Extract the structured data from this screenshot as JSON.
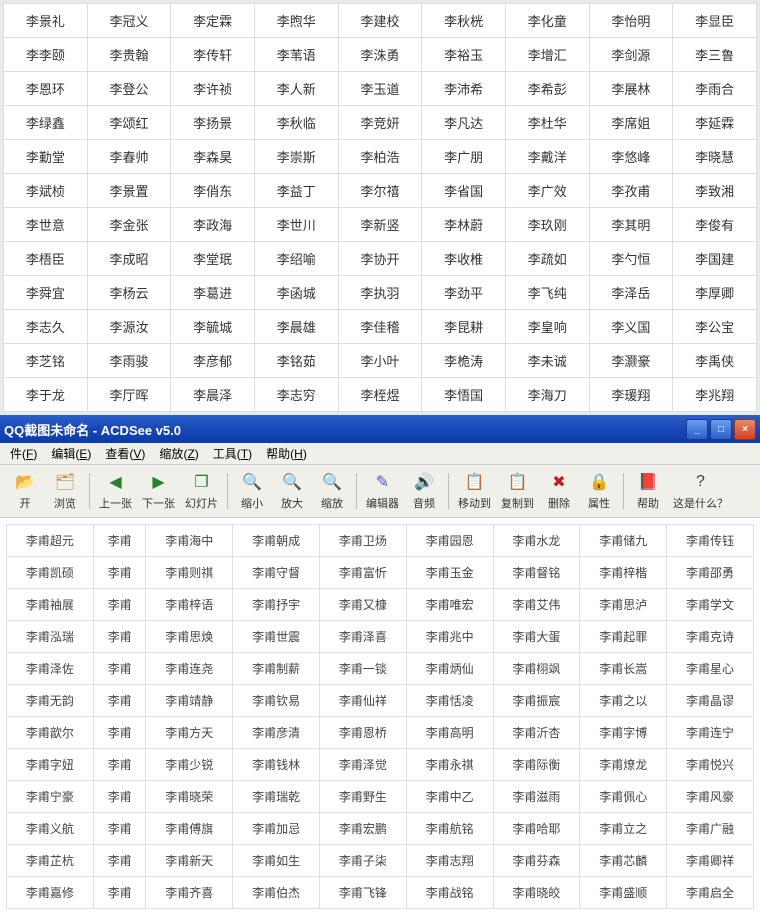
{
  "topTable": [
    [
      "李景礼",
      "李冠义",
      "李定霖",
      "李煦华",
      "李建校",
      "李秋桄",
      "李化童",
      "李怡明",
      "李显臣"
    ],
    [
      "李李颐",
      "李贵翰",
      "李传轩",
      "李苇语",
      "李洙勇",
      "李裕玉",
      "李增汇",
      "李剑源",
      "李三鲁"
    ],
    [
      "李恩环",
      "李登公",
      "李许祯",
      "李人新",
      "李玉道",
      "李沛希",
      "李希彭",
      "李展林",
      "李雨合"
    ],
    [
      "李绿鑫",
      "李颂红",
      "李扬景",
      "李秋临",
      "李竞妍",
      "李凡达",
      "李杜华",
      "李席姐",
      "李延霖"
    ],
    [
      "李勤堂",
      "李春帅",
      "李森昊",
      "李崇斯",
      "李柏浩",
      "李广朋",
      "李戴洋",
      "李悠峰",
      "李晓慧"
    ],
    [
      "李斌桢",
      "李景置",
      "李俏东",
      "李益丁",
      "李尔禧",
      "李省国",
      "李广效",
      "李孜甫",
      "李致湘"
    ],
    [
      "李世意",
      "李金张",
      "李政海",
      "李世川",
      "李新竖",
      "李林蔚",
      "李玖刚",
      "李其明",
      "李俊有"
    ],
    [
      "李梧臣",
      "李成昭",
      "李堂珉",
      "李绍喻",
      "李协开",
      "李收椎",
      "李疏如",
      "李勺恒",
      "李国建"
    ],
    [
      "李舜宜",
      "李杨云",
      "李葛进",
      "李函城",
      "李执羽",
      "李劲平",
      "李飞纯",
      "李泽岳",
      "李厚卿"
    ],
    [
      "李志久",
      "李源汝",
      "李毓城",
      "李晨雄",
      "李佳稽",
      "李昆耕",
      "李皇响",
      "李义国",
      "李公宝"
    ],
    [
      "李芝铭",
      "李雨骏",
      "李彦郁",
      "李铭茹",
      "李小叶",
      "李桅涛",
      "李未诚",
      "李灏豪",
      "李禹侠"
    ],
    [
      "李于龙",
      "李厅晖",
      "李晨泽",
      "李志穷",
      "李桎煜",
      "李悟国",
      "李海刀",
      "李瑗翔",
      "李兆翔"
    ]
  ],
  "titlebar": {
    "title": "QQ截图未命名 - ACDSee v5.0"
  },
  "winControls": {
    "min": "_",
    "max": "□",
    "close": "×"
  },
  "menubar": [
    {
      "label": "件",
      "key": "F"
    },
    {
      "label": "编辑",
      "key": "E"
    },
    {
      "label": "查看",
      "key": "V"
    },
    {
      "label": "缩放",
      "key": "Z"
    },
    {
      "label": "工具",
      "key": "T"
    },
    {
      "label": "帮助",
      "key": "H"
    }
  ],
  "toolbar": [
    {
      "type": "btn",
      "name": "open",
      "label": "开",
      "icon": "📂",
      "color": "#d8a040"
    },
    {
      "type": "btn",
      "name": "browse",
      "label": "浏览",
      "icon": "🗂",
      "color": "#c8904d"
    },
    {
      "type": "sep"
    },
    {
      "type": "btn",
      "name": "prev",
      "label": "上一张",
      "icon": "◀",
      "color": "#2a8030"
    },
    {
      "type": "btn",
      "name": "next",
      "label": "下一张",
      "icon": "▶",
      "color": "#2a8030"
    },
    {
      "type": "btn",
      "name": "slideshow",
      "label": "幻灯片",
      "icon": "❐",
      "color": "#2a8030"
    },
    {
      "type": "sep"
    },
    {
      "type": "btn",
      "name": "zoomout",
      "label": "缩小",
      "icon": "🔍",
      "color": "#888"
    },
    {
      "type": "btn",
      "name": "zoomin",
      "label": "放大",
      "icon": "🔍",
      "color": "#888"
    },
    {
      "type": "btn",
      "name": "zoom",
      "label": "缩放",
      "icon": "🔍",
      "color": "#888"
    },
    {
      "type": "sep"
    },
    {
      "type": "btn",
      "name": "editor",
      "label": "编辑器",
      "icon": "✎",
      "color": "#4060c0"
    },
    {
      "type": "btn",
      "name": "audio",
      "label": "音频",
      "icon": "🔊",
      "color": "#d89020"
    },
    {
      "type": "sep"
    },
    {
      "type": "btn",
      "name": "moveto",
      "label": "移动到",
      "icon": "📋",
      "color": "#c08050"
    },
    {
      "type": "btn",
      "name": "copyto",
      "label": "复制到",
      "icon": "📋",
      "color": "#c08050"
    },
    {
      "type": "btn",
      "name": "delete",
      "label": "删除",
      "icon": "✖",
      "color": "#c02020"
    },
    {
      "type": "btn",
      "name": "props",
      "label": "属性",
      "icon": "🔒",
      "color": "#c0a020"
    },
    {
      "type": "sep"
    },
    {
      "type": "btn",
      "name": "help",
      "label": "帮助",
      "icon": "📕",
      "color": "#b02030"
    },
    {
      "type": "btn",
      "name": "whatsthis",
      "label": "这是什么？",
      "icon": "?",
      "color": "#404040"
    }
  ],
  "bottomTable": [
    [
      "李甫超元",
      "李甫",
      "李甫海中",
      "李甫朝成",
      "李甫卫炀",
      "李甫园恩",
      "李甫水龙",
      "李甫储九",
      "李甫传钰"
    ],
    [
      "李甫凯硕",
      "李甫",
      "李甫则祺",
      "李甫守督",
      "李甫富忻",
      "李甫玉金",
      "李甫督铭",
      "李甫梓楷",
      "李甫邵勇"
    ],
    [
      "李甫袖展",
      "李甫",
      "李甫梓语",
      "李甫抒宇",
      "李甫又槺",
      "李甫唯宏",
      "李甫艾伟",
      "李甫思泸",
      "李甫学文"
    ],
    [
      "李甫泓瑞",
      "李甫",
      "李甫思焕",
      "李甫世震",
      "李甫泽喜",
      "李甫兆中",
      "李甫大蛋",
      "李甫起罪",
      "李甫克诗"
    ],
    [
      "李甫泽佐",
      "李甫",
      "李甫连尧",
      "李甫制薪",
      "李甫一锬",
      "李甫炳仙",
      "李甫栩飒",
      "李甫长嵩",
      "李甫星心"
    ],
    [
      "李甫无韵",
      "李甫",
      "李甫靖静",
      "李甫钦易",
      "李甫仙祥",
      "李甫恬凌",
      "李甫振宸",
      "李甫之以",
      "李甫晶谬"
    ],
    [
      "李甫歆尔",
      "李甫",
      "李甫方天",
      "李甫彦清",
      "李甫恩桥",
      "李甫高明",
      "李甫沂杏",
      "李甫字博",
      "李甫连宁"
    ],
    [
      "李甫字妞",
      "李甫",
      "李甫少锐",
      "李甫钱林",
      "李甫泽觉",
      "李甫永祺",
      "李甫际衡",
      "李甫燎龙",
      "李甫悦兴"
    ],
    [
      "李甫宁豪",
      "李甫",
      "李甫晓荣",
      "李甫瑞乾",
      "李甫野生",
      "李甫中乙",
      "李甫滋雨",
      "李甫佩心",
      "李甫风豪"
    ],
    [
      "李甫义航",
      "李甫",
      "李甫傅旗",
      "李甫加忌",
      "李甫宏鹏",
      "李甫航铭",
      "李甫哈耶",
      "李甫立之",
      "李甫广融"
    ],
    [
      "李甫芷杭",
      "李甫",
      "李甫新天",
      "李甫如生",
      "李甫子柒",
      "李甫志翔",
      "李甫芬森",
      "李甫芯麟",
      "李甫卿祥"
    ],
    [
      "李甫嘉修",
      "李甫",
      "李甫齐喜",
      "李甫伯杰",
      "李甫飞锋",
      "李甫战铭",
      "李甫晓皎",
      "李甫盛顺",
      "李甫启全"
    ]
  ]
}
